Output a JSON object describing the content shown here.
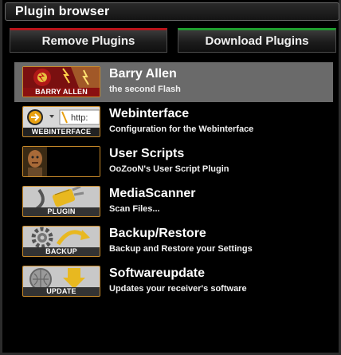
{
  "window": {
    "title": "Plugin browser"
  },
  "buttons": {
    "remove_label": "Remove Plugins",
    "download_label": "Download Plugins",
    "remove_color": "#b8141a",
    "download_color": "#1f9c2e"
  },
  "plugins": [
    {
      "name": "Barry Allen",
      "description": "the second Flash",
      "thumb_label": "BARRY ALLEN",
      "icon": "flash-hero-icon",
      "selected": true
    },
    {
      "name": "Webinterface",
      "description": "Configuration for the Webinterface",
      "thumb_label": "WEBINTERFACE",
      "icon": "browser-address-icon",
      "selected": false
    },
    {
      "name": "User Scripts",
      "description": "OoZooN's User Script Plugin",
      "thumb_label": "",
      "icon": "character-portrait-icon",
      "selected": false
    },
    {
      "name": "MediaScanner",
      "description": "Scan Files...",
      "thumb_label": "PLUGIN",
      "icon": "plug-icon",
      "selected": false
    },
    {
      "name": "Backup/Restore",
      "description": "Backup and Restore your Settings",
      "thumb_label": "BACKUP",
      "icon": "backup-gear-icon",
      "selected": false
    },
    {
      "name": "Softwareupdate",
      "description": "Updates your receiver's software",
      "thumb_label": "UPDATE",
      "icon": "update-arrow-icon",
      "selected": false
    }
  ],
  "colors": {
    "selection": "#6a6a6a",
    "thumb_border": "#c98a2a"
  }
}
